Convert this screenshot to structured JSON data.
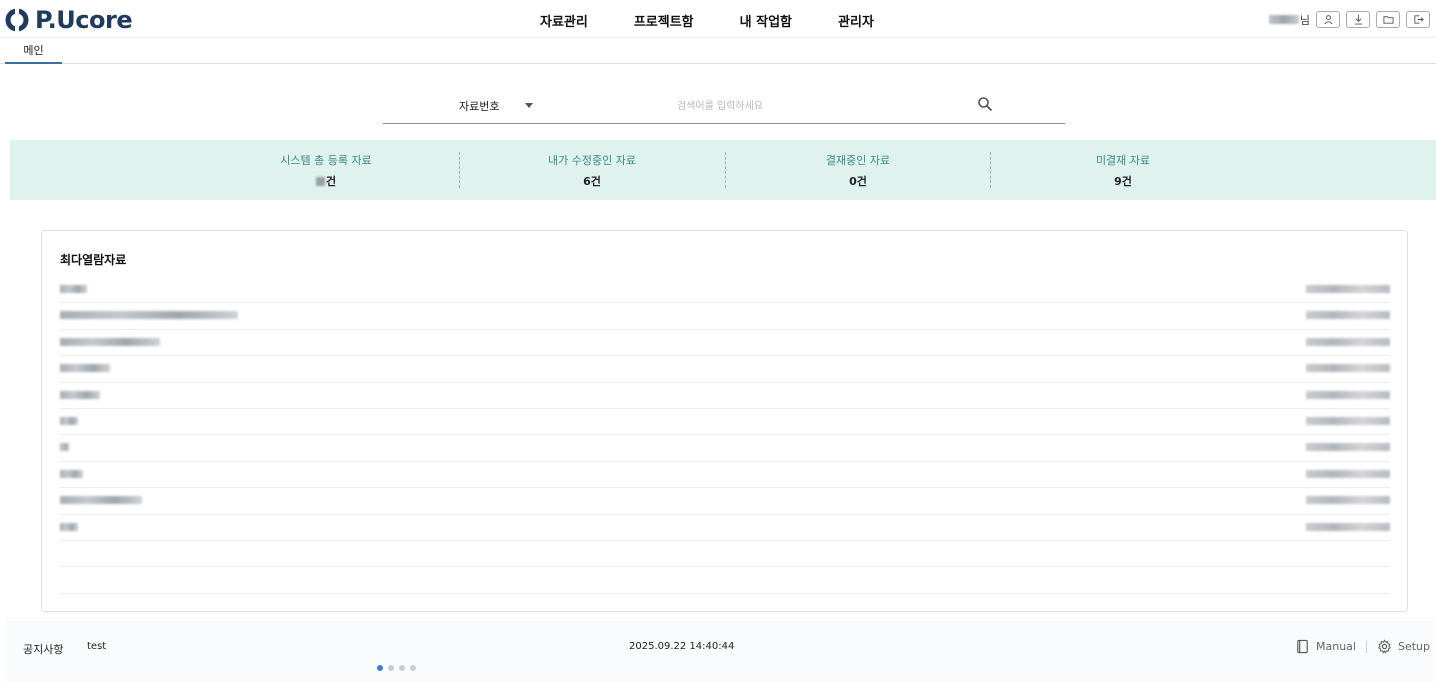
{
  "header": {
    "logo_text": "P.Ucore",
    "nav": [
      "자료관리",
      "프로젝트함",
      "내 작업함",
      "관리자"
    ],
    "user_suffix": "님",
    "buttons": [
      "user-icon",
      "download-icon",
      "folder-icon",
      "logout-icon"
    ]
  },
  "tabs": [
    "메인"
  ],
  "search": {
    "type": "자료번호",
    "placeholder": "검색어를 입력하세요"
  },
  "stats": [
    {
      "label": "시스템 총 등록 자료",
      "value": "건"
    },
    {
      "label": "내가 수정중인 자료",
      "value": "6건"
    },
    {
      "label": "결재중인 자료",
      "value": "0건"
    },
    {
      "label": "미결재 자료",
      "value": "9건"
    }
  ],
  "card": {
    "title": "최다열람자료",
    "rows": 10,
    "empty_rows": 2
  },
  "footer": {
    "notice_label": "공지사항",
    "notice_text": "test",
    "notice_time": "2025.09.22 14:40:44",
    "pager_total": 4,
    "pager_active": 0,
    "manual_label": "Manual",
    "setup_label": "Setup"
  },
  "colors": {
    "brand": "#1f3a5f",
    "stats_bg": "#dff2ee",
    "stats_label": "#3d8a80",
    "accent": "#3a7bd5"
  }
}
